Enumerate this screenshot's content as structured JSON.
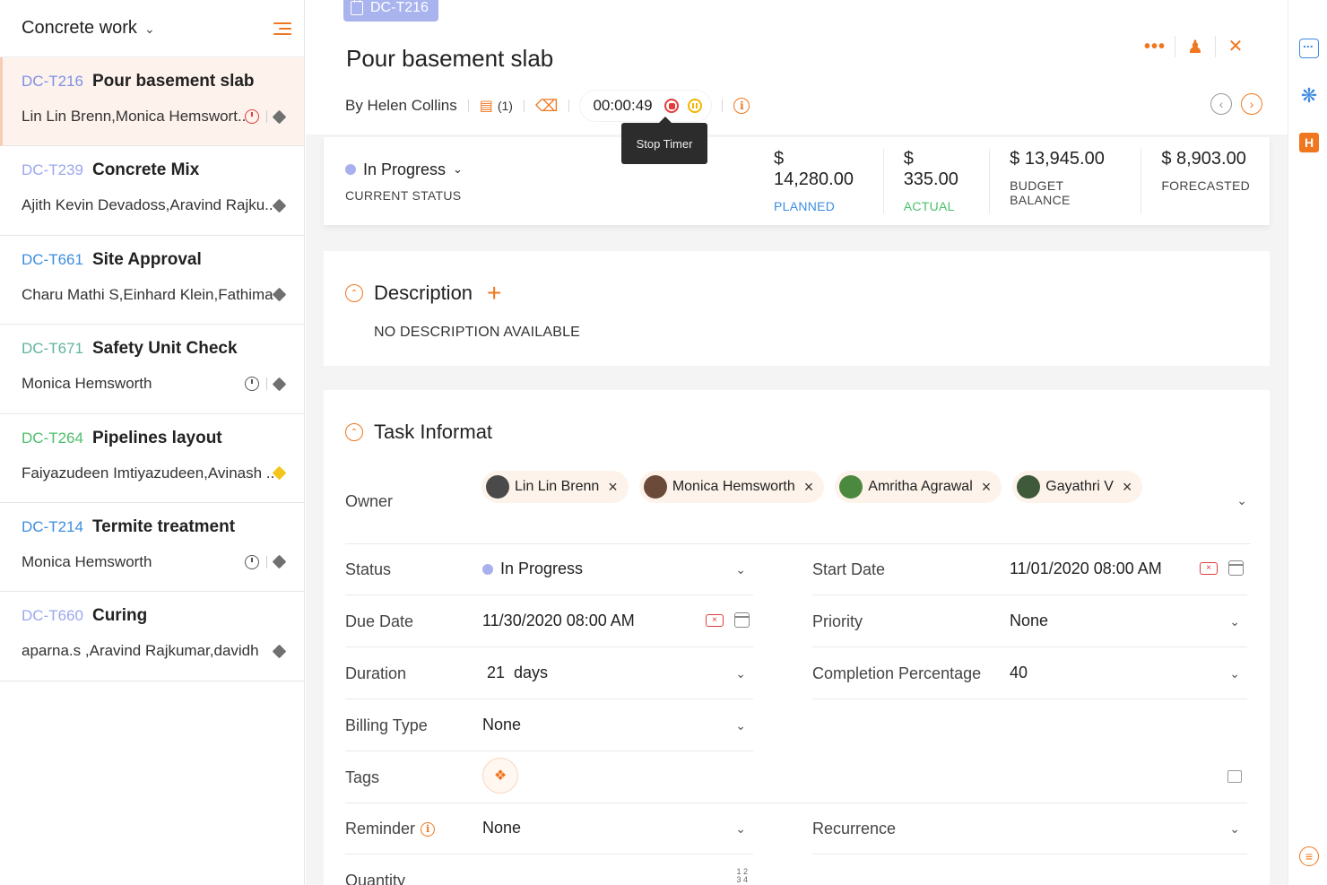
{
  "sidebar": {
    "project_name": "Concrete work",
    "tasks": [
      {
        "id": "DC-T216",
        "name": "Pour basement slab",
        "owners": "Lin Lin Brenn,Monica Hemswort...",
        "id_color": "#7f90e6",
        "timer": "red",
        "diamond": "grey",
        "active": true
      },
      {
        "id": "DC-T239",
        "name": "Concrete Mix",
        "owners": "Ajith Kevin Devadoss,Aravind Rajku...",
        "id_color": "#9aa7ee",
        "timer": "",
        "diamond": "grey"
      },
      {
        "id": "DC-T661",
        "name": "Site Approval",
        "owners": "Charu Mathi S,Einhard Klein,Fathima...",
        "id_color": "#3c8de0",
        "timer": "",
        "diamond": "grey"
      },
      {
        "id": "DC-T671",
        "name": "Safety Unit Check",
        "owners": "Monica Hemsworth",
        "id_color": "#5fb3a0",
        "timer": "grey",
        "diamond": "grey"
      },
      {
        "id": "DC-T264",
        "name": "Pipelines layout",
        "owners": "Faiyazudeen Imtiyazudeen,Avinash ...",
        "id_color": "#4bbf6b",
        "timer": "",
        "diamond": "yellow"
      },
      {
        "id": "DC-T214",
        "name": "Termite treatment",
        "owners": "Monica Hemsworth",
        "id_color": "#3c8de0",
        "timer": "grey",
        "diamond": "grey"
      },
      {
        "id": "DC-T660",
        "name": "Curing",
        "owners": "aparna.s ,Aravind Rajkumar,davidh",
        "id_color": "#9aa7ee",
        "timer": "",
        "diamond": "grey"
      }
    ]
  },
  "detail": {
    "badge": "DC-T216",
    "title": "Pour basement slab",
    "author": "By Helen Collins",
    "comments_count": "(1)",
    "timer": "00:00:49",
    "tooltip": "Stop Timer",
    "status": "In Progress",
    "status_label": "CURRENT STATUS",
    "budget": [
      {
        "value": "$ 14,280.00",
        "label": "PLANNED",
        "color": "#3c8de0"
      },
      {
        "value": "$ 335.00",
        "label": "ACTUAL",
        "color": "#4bbf6b"
      },
      {
        "value": "$ 13,945.00",
        "label": "BUDGET BALANCE",
        "color": "#444444"
      },
      {
        "value": "$ 8,903.00",
        "label": "FORECASTED",
        "color": "#444444"
      }
    ]
  },
  "description": {
    "title": "Description",
    "empty_text": "NO DESCRIPTION AVAILABLE"
  },
  "task_info": {
    "title": "Task Informat",
    "owner_label": "Owner",
    "owners": [
      {
        "name": "Lin Lin Brenn",
        "avatar_color": "#4a4a4a"
      },
      {
        "name": "Monica Hemsworth",
        "avatar_color": "#6b4a3a"
      },
      {
        "name": "Amritha Agrawal",
        "avatar_color": "#4b8a3e"
      },
      {
        "name": "Gayathri V",
        "avatar_color": "#3e5a3a"
      }
    ],
    "fields": {
      "status_label": "Status",
      "status_value": "In Progress",
      "start_label": "Start Date",
      "start_value": "11/01/2020 08:00 AM",
      "due_label": "Due Date",
      "due_value": "11/30/2020 08:00 AM",
      "priority_label": "Priority",
      "priority_value": "None",
      "duration_label": "Duration",
      "duration_value": "21  days",
      "completion_label": "Completion Percentage",
      "completion_value": "40",
      "billing_label": "Billing Type",
      "billing_value": "None",
      "tags_label": "Tags",
      "reminder_label": "Reminder",
      "reminder_value": "None",
      "recurrence_label": "Recurrence",
      "quantity_label": "Quantity"
    }
  },
  "rail": {
    "h_label": "H"
  }
}
